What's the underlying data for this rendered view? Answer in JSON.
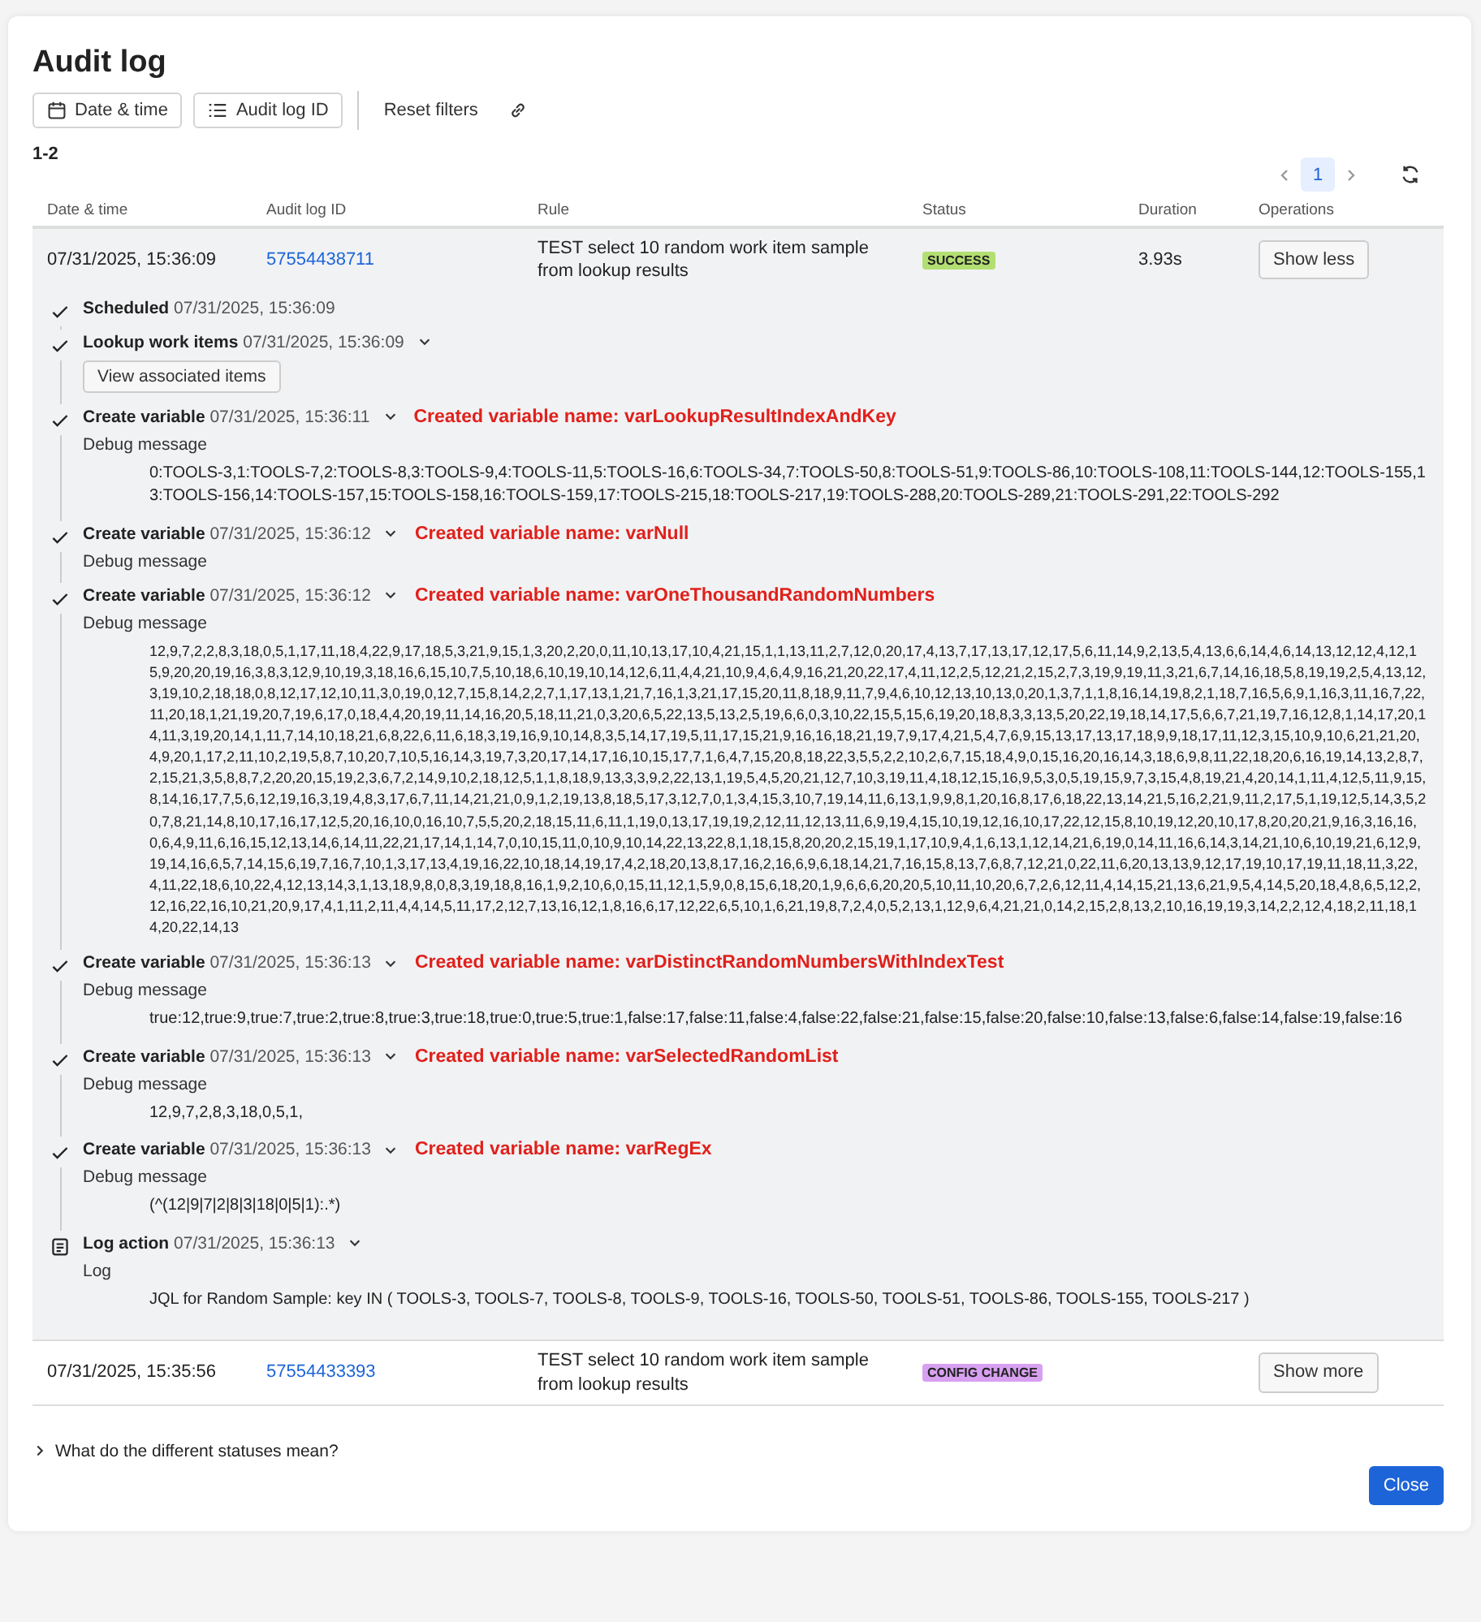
{
  "dialog": {
    "title": "Audit log"
  },
  "filters": [
    {
      "kind": "calendar",
      "label": "Date & time"
    },
    {
      "kind": "list",
      "label": "Audit log ID"
    }
  ],
  "reset_label": "Reset filters",
  "result_count": "1-2",
  "pagination": {
    "pages": [
      {
        "label": "1",
        "selected": true
      }
    ]
  },
  "table": {
    "columns": [
      "Date & time",
      "Audit log ID",
      "Rule",
      "Status",
      "Duration",
      "Operations"
    ],
    "rows": [
      {
        "date": "07/31/2025, 15:36:09",
        "id": "57554438711",
        "rule": "TEST select 10 random work item sample from lookup results",
        "status": "SUCCESS",
        "color": "#b3df72",
        "duration": "3.93s",
        "action": "Show less",
        "expanded": true,
        "steps": [
          {
            "kind": "check",
            "title": "Scheduled",
            "time": "07/31/2025, 15:36:09",
            "caret": false
          },
          {
            "kind": "check",
            "title": "Lookup work items",
            "time": "07/31/2025, 15:36:09",
            "caret": true,
            "button": "View associated items"
          },
          {
            "kind": "check",
            "title": "Create variable",
            "time": "07/31/2025, 15:36:11",
            "caret": true,
            "annotation": "Created variable name: varLookupResultIndexAndKey",
            "detail_label": "Debug message",
            "detail": "0:TOOLS-3,1:TOOLS-7,2:TOOLS-8,3:TOOLS-9,4:TOOLS-11,5:TOOLS-16,6:TOOLS-34,7:TOOLS-50,8:TOOLS-51,9:TOOLS-86,10:TOOLS-108,11:TOOLS-144,12:TOOLS-155,13:TOOLS-156,14:TOOLS-157,15:TOOLS-158,16:TOOLS-159,17:TOOLS-215,18:TOOLS-217,19:TOOLS-288,20:TOOLS-289,21:TOOLS-291,22:TOOLS-292"
          },
          {
            "kind": "check",
            "title": "Create variable",
            "time": "07/31/2025, 15:36:12",
            "caret": true,
            "annotation": "Created variable name: varNull",
            "detail_label": "Debug message"
          },
          {
            "kind": "check",
            "title": "Create variable",
            "time": "07/31/2025, 15:36:12",
            "caret": true,
            "annotation": "Created variable name: varOneThousandRandomNumbers",
            "detail_label": "Debug message",
            "dense": true,
            "detail": "12,9,7,2,2,8,3,18,0,5,1,17,11,18,4,22,9,17,18,5,3,21,9,15,1,3,20,2,20,0,11,10,13,17,10,4,21,15,1,1,13,11,2,7,12,0,20,17,4,13,7,17,13,17,12,17,5,6,11,14,9,2,13,5,4,13,6,6,14,4,6,14,13,12,12,4,12,15,9,20,20,19,16,3,8,3,12,9,10,19,3,18,16,6,15,10,7,5,10,18,6,10,19,10,14,12,6,11,4,4,21,10,9,4,6,4,9,16,21,20,22,17,4,11,12,2,5,12,21,2,15,2,7,3,19,9,19,11,3,21,6,7,14,16,18,5,8,19,19,2,5,4,13,12,3,19,10,2,18,18,0,8,12,17,12,10,11,3,0,19,0,12,7,15,8,14,2,2,7,1,17,13,1,21,7,16,1,3,21,17,15,20,11,8,18,9,11,7,9,4,6,10,12,13,10,13,0,20,1,3,7,1,1,8,16,14,19,8,2,1,18,7,16,5,6,9,1,16,3,11,16,7,22,11,20,18,1,21,19,20,7,19,6,17,0,18,4,4,20,19,11,14,16,20,5,18,11,21,0,3,20,6,5,22,13,5,13,2,5,19,6,6,0,3,10,22,15,5,15,6,19,20,18,8,3,3,13,5,20,22,19,18,14,17,5,6,6,7,21,19,7,16,12,8,1,14,17,20,14,11,3,19,20,14,1,11,7,14,10,18,21,6,8,22,6,11,6,18,3,19,16,9,10,14,8,3,5,14,17,19,5,11,17,15,21,9,16,16,18,21,19,7,9,17,4,21,5,4,7,6,9,15,13,17,13,17,18,9,9,18,17,11,12,3,15,10,9,10,6,21,21,20,4,9,20,1,17,2,11,10,2,19,5,8,7,10,20,7,10,5,16,14,3,19,7,3,20,17,14,17,16,10,15,17,7,1,6,4,7,15,20,8,18,22,3,5,5,2,2,10,2,6,7,15,18,4,9,0,15,16,20,16,14,3,18,6,9,8,11,22,18,20,6,16,19,14,13,2,8,7,2,15,21,3,5,8,8,7,2,20,20,15,19,2,3,6,7,2,14,9,10,2,18,12,5,1,1,8,18,9,13,3,3,9,2,22,13,1,19,5,4,5,20,21,12,7,10,3,19,11,4,18,12,15,16,9,5,3,0,5,19,15,9,7,3,15,4,8,19,21,4,20,14,1,11,4,12,5,11,9,15,8,14,16,17,7,5,6,12,19,16,3,19,4,8,3,17,6,7,11,14,21,21,0,9,1,2,19,13,8,18,5,17,3,12,7,0,1,3,4,15,3,10,7,19,14,11,6,13,1,9,9,8,1,20,16,8,17,6,18,22,13,14,21,5,16,2,21,9,11,2,17,5,1,19,12,5,14,3,5,20,7,8,21,14,8,10,17,16,17,12,5,20,16,10,0,16,10,7,5,5,20,2,18,15,11,6,11,1,19,0,13,17,19,19,2,12,11,12,13,11,6,9,19,4,15,10,19,12,16,10,17,22,12,15,8,10,19,12,20,10,17,8,20,20,21,9,16,3,16,16,0,6,4,9,11,6,16,15,12,13,14,6,14,11,22,21,17,14,1,14,7,0,10,15,11,0,10,9,10,14,22,13,22,8,1,18,15,8,20,20,2,15,19,1,17,10,9,4,1,6,13,1,12,14,21,6,19,0,14,11,16,6,14,3,14,21,10,6,10,19,21,6,12,9,19,14,16,6,5,7,14,15,6,19,7,16,7,10,1,3,17,13,4,19,16,22,10,18,14,19,17,4,2,18,20,13,8,17,16,2,16,6,9,6,18,14,21,7,16,15,8,13,7,6,8,7,12,21,0,22,11,6,20,13,13,9,12,17,19,10,17,19,11,18,11,3,22,4,11,22,18,6,10,22,4,12,13,14,3,1,13,18,9,8,0,8,3,19,18,8,16,1,9,2,10,6,0,15,11,12,1,5,9,0,8,15,6,18,20,1,9,6,6,6,20,20,5,10,11,10,20,6,7,2,6,12,11,4,14,15,21,13,6,21,9,5,4,14,5,20,18,4,8,6,5,12,2,12,16,22,16,10,21,20,9,17,4,1,11,2,11,4,4,14,5,11,17,2,12,7,13,16,12,1,8,16,6,17,12,22,6,5,10,1,6,21,19,8,7,2,4,0,5,2,13,1,12,9,6,4,21,21,0,14,2,15,2,8,13,2,10,16,19,19,3,14,2,2,12,4,18,2,11,18,14,20,22,14,13"
          },
          {
            "kind": "check",
            "title": "Create variable",
            "time": "07/31/2025, 15:36:13",
            "caret": true,
            "annotation": "Created variable name: varDistinctRandomNumbersWithIndexTest",
            "detail_label": "Debug message",
            "detail": "true:12,true:9,true:7,true:2,true:8,true:3,true:18,true:0,true:5,true:1,false:17,false:11,false:4,false:22,false:21,false:15,false:20,false:10,false:13,false:6,false:14,false:19,false:16"
          },
          {
            "kind": "check",
            "title": "Create variable",
            "time": "07/31/2025, 15:36:13",
            "caret": true,
            "annotation": "Created variable name: varSelectedRandomList",
            "detail_label": "Debug message",
            "detail": "12,9,7,2,8,3,18,0,5,1,"
          },
          {
            "kind": "check",
            "title": "Create variable",
            "time": "07/31/2025, 15:36:13",
            "caret": true,
            "annotation": "Created variable name: varRegEx",
            "detail_label": "Debug message",
            "detail": "(^(12|9|7|2|8|3|18|0|5|1):.*)"
          },
          {
            "kind": "log",
            "title": "Log action",
            "time": "07/31/2025, 15:36:13",
            "caret": true,
            "detail_label": "Log",
            "detail": "JQL for Random Sample: key IN ( TOOLS-3, TOOLS-7, TOOLS-8, TOOLS-9, TOOLS-16, TOOLS-50, TOOLS-51, TOOLS-86, TOOLS-155, TOOLS-217 )"
          }
        ]
      },
      {
        "date": "07/31/2025, 15:35:56",
        "id": "57554433393",
        "rule": "TEST select 10 random work item sample from lookup results",
        "status": "CONFIG CHANGE",
        "color": "#d8a0f0",
        "action": "Show more",
        "expanded": false
      }
    ]
  },
  "help_toggle": {
    "label": "What do the different statuses mean?",
    "expanded": false
  },
  "close_label": "Close"
}
